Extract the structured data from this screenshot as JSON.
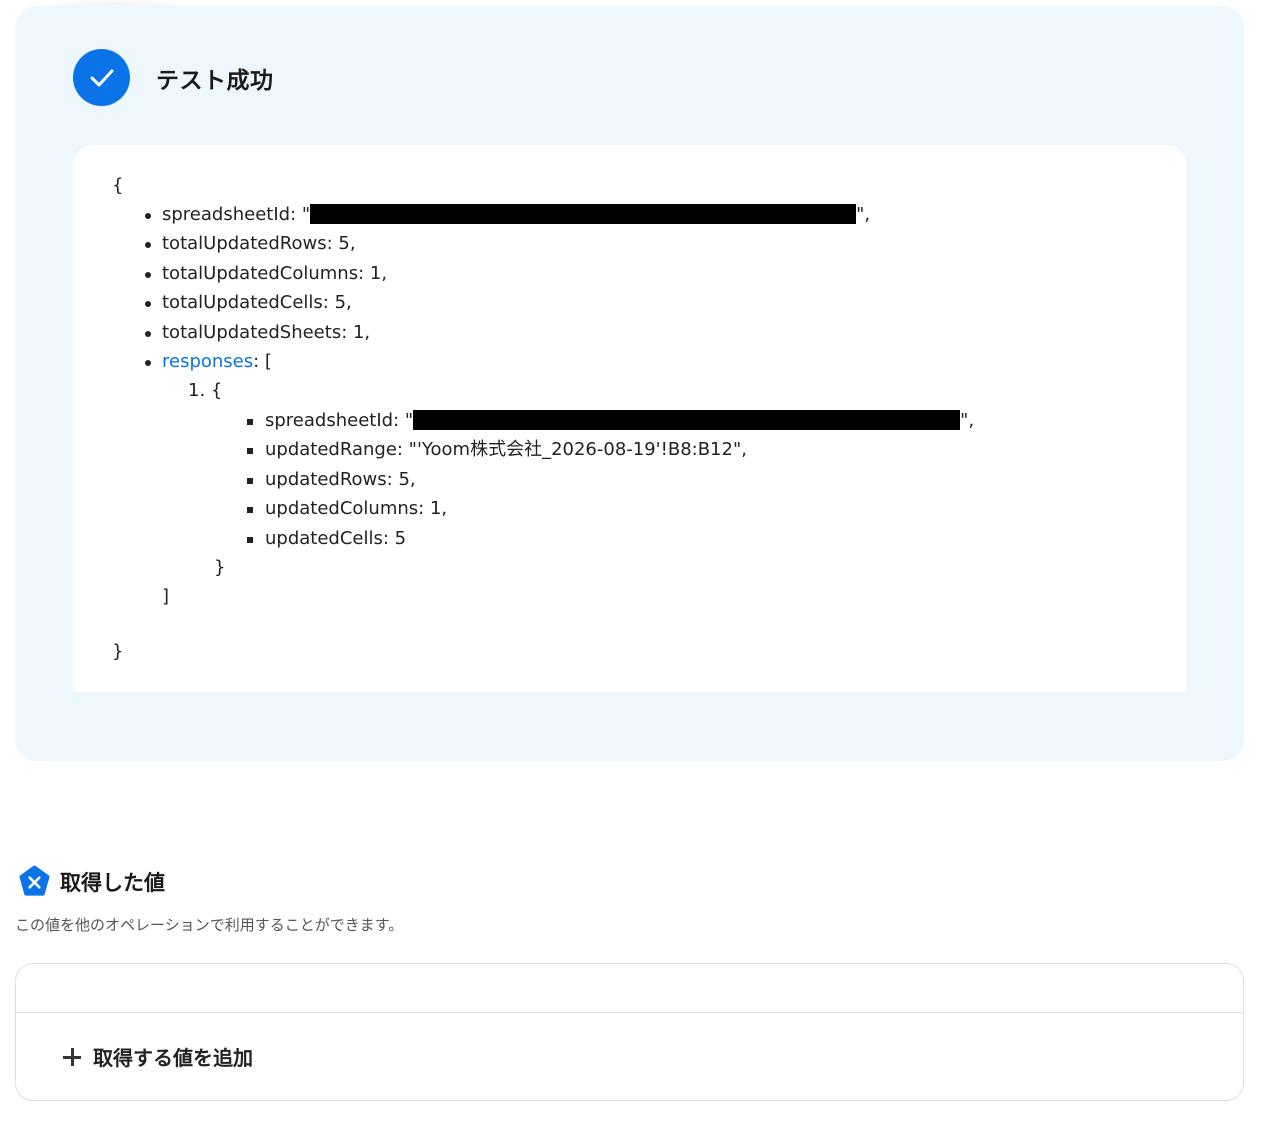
{
  "test_result": {
    "title": "テスト成功",
    "json_lines": {
      "open_brace": "{",
      "spreadsheet_id_key": "spreadsheetId: \"",
      "spreadsheet_id_suffix": "\",",
      "total_updated_rows": "totalUpdatedRows: 5,",
      "total_updated_columns": "totalUpdatedColumns: 1,",
      "total_updated_cells": "totalUpdatedCells: 5,",
      "total_updated_sheets": "totalUpdatedSheets: 1,",
      "responses_key": "responses",
      "responses_suffix": ": [",
      "item_index": "1. {",
      "item_spreadsheet_id_key": "spreadsheetId: \"",
      "item_spreadsheet_id_suffix": "\",",
      "updated_range": "updatedRange: \"'Yoom株式会社_2026-08-19'!B8:B12\",",
      "updated_rows": "updatedRows: 5,",
      "updated_columns": "updatedColumns: 1,",
      "updated_cells": "updatedCells: 5",
      "item_close": "}",
      "array_close": "]",
      "close_brace": "}"
    }
  },
  "acquired_values": {
    "title": "取得した値",
    "description": "この値を他のオペレーションで利用することができます。",
    "add_button_label": "取得する値を追加"
  },
  "colors": {
    "accent": "#0a73e8",
    "panel_background": "#eef6fe"
  },
  "icons": {
    "success": "check-circle-icon",
    "values": "variable-pentagon-icon",
    "add": "plus-icon"
  }
}
